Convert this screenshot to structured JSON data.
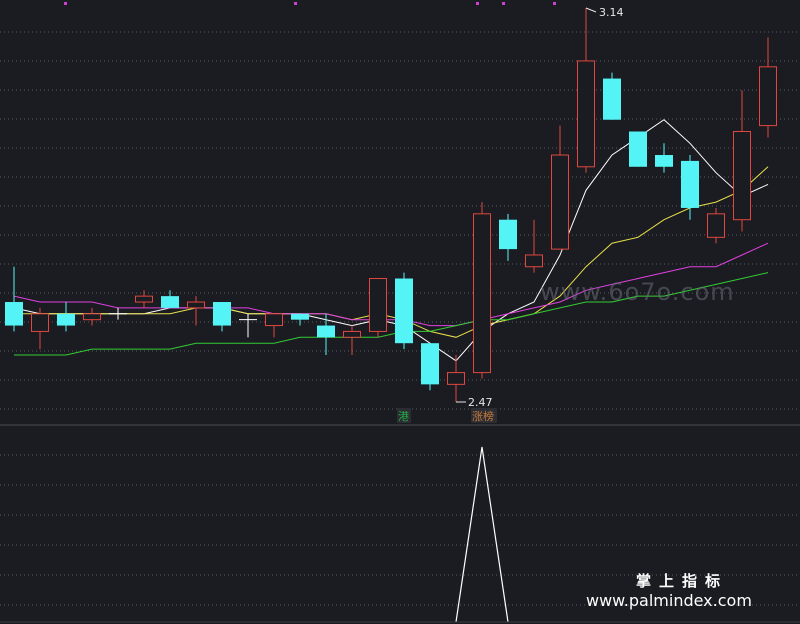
{
  "chart_data": {
    "type": "candlestick",
    "candles": [
      {
        "o": 2.64,
        "h": 2.7,
        "l": 2.59,
        "c": 2.6
      },
      {
        "o": 2.59,
        "h": 2.63,
        "l": 2.56,
        "c": 2.62
      },
      {
        "o": 2.62,
        "h": 2.64,
        "l": 2.59,
        "c": 2.6
      },
      {
        "o": 2.61,
        "h": 2.63,
        "l": 2.6,
        "c": 2.62
      },
      {
        "o": 2.62,
        "h": 2.63,
        "l": 2.61,
        "c": 2.62
      },
      {
        "o": 2.64,
        "h": 2.66,
        "l": 2.63,
        "c": 2.65
      },
      {
        "o": 2.65,
        "h": 2.66,
        "l": 2.63,
        "c": 2.63
      },
      {
        "o": 2.63,
        "h": 2.65,
        "l": 2.6,
        "c": 2.64
      },
      {
        "o": 2.64,
        "h": 2.64,
        "l": 2.59,
        "c": 2.6
      },
      {
        "o": 2.61,
        "h": 2.62,
        "l": 2.58,
        "c": 2.61
      },
      {
        "o": 2.6,
        "h": 2.61,
        "l": 2.58,
        "c": 2.62
      },
      {
        "o": 2.62,
        "h": 2.62,
        "l": 2.6,
        "c": 2.61
      },
      {
        "o": 2.6,
        "h": 2.62,
        "l": 2.55,
        "c": 2.58
      },
      {
        "o": 2.58,
        "h": 2.6,
        "l": 2.55,
        "c": 2.59
      },
      {
        "o": 2.59,
        "h": 2.68,
        "l": 2.58,
        "c": 2.68
      },
      {
        "o": 2.68,
        "h": 2.69,
        "l": 2.56,
        "c": 2.57
      },
      {
        "o": 2.57,
        "h": 2.57,
        "l": 2.49,
        "c": 2.5
      },
      {
        "o": 2.5,
        "h": 2.55,
        "l": 2.47,
        "c": 2.52
      },
      {
        "o": 2.52,
        "h": 2.81,
        "l": 2.51,
        "c": 2.79
      },
      {
        "o": 2.78,
        "h": 2.79,
        "l": 2.71,
        "c": 2.73
      },
      {
        "o": 2.7,
        "h": 2.78,
        "l": 2.69,
        "c": 2.72
      },
      {
        "o": 2.73,
        "h": 2.94,
        "l": 2.73,
        "c": 2.89
      },
      {
        "o": 2.87,
        "h": 3.14,
        "l": 2.86,
        "c": 3.05
      },
      {
        "o": 3.02,
        "h": 3.03,
        "l": 2.95,
        "c": 2.95
      },
      {
        "o": 2.93,
        "h": 2.93,
        "l": 2.87,
        "c": 2.87
      },
      {
        "o": 2.89,
        "h": 2.91,
        "l": 2.86,
        "c": 2.87
      },
      {
        "o": 2.88,
        "h": 2.89,
        "l": 2.78,
        "c": 2.8
      },
      {
        "o": 2.75,
        "h": 2.8,
        "l": 2.74,
        "c": 2.79
      },
      {
        "o": 2.78,
        "h": 3.0,
        "l": 2.76,
        "c": 2.93
      },
      {
        "o": 2.94,
        "h": 3.09,
        "l": 2.92,
        "c": 3.04
      }
    ],
    "high_label": "3.14",
    "low_label": "2.47",
    "tags": [
      {
        "text": "港",
        "index": 15,
        "color": "#22aa44"
      },
      {
        "text": "涨榜",
        "index": 18,
        "color": "#c87a3a"
      }
    ],
    "moving_averages": [
      {
        "color": "#ffffff",
        "values": [
          2.63,
          2.62,
          2.62,
          2.62,
          2.62,
          2.62,
          2.63,
          2.63,
          2.63,
          2.62,
          2.62,
          2.62,
          2.61,
          2.6,
          2.61,
          2.6,
          2.57,
          2.54,
          2.59,
          2.62,
          2.64,
          2.72,
          2.83,
          2.89,
          2.92,
          2.95,
          2.91,
          2.86,
          2.82,
          2.84
        ]
      },
      {
        "color": "#e8e04a",
        "values": [
          2.62,
          2.62,
          2.62,
          2.62,
          2.62,
          2.62,
          2.62,
          2.63,
          2.63,
          2.62,
          2.62,
          2.62,
          2.62,
          2.61,
          2.62,
          2.61,
          2.59,
          2.58,
          2.6,
          2.61,
          2.62,
          2.65,
          2.7,
          2.74,
          2.75,
          2.78,
          2.8,
          2.81,
          2.83,
          2.87
        ]
      },
      {
        "color": "#e040e0",
        "values": [
          2.65,
          2.64,
          2.64,
          2.64,
          2.63,
          2.63,
          2.63,
          2.63,
          2.63,
          2.63,
          2.62,
          2.62,
          2.62,
          2.61,
          2.61,
          2.61,
          2.6,
          2.6,
          2.61,
          2.62,
          2.63,
          2.64,
          2.66,
          2.67,
          2.68,
          2.69,
          2.7,
          2.7,
          2.72,
          2.74
        ]
      },
      {
        "color": "#33cc33",
        "values": [
          2.55,
          2.55,
          2.55,
          2.56,
          2.56,
          2.56,
          2.56,
          2.57,
          2.57,
          2.57,
          2.57,
          2.58,
          2.58,
          2.58,
          2.58,
          2.59,
          2.59,
          2.6,
          2.61,
          2.61,
          2.62,
          2.63,
          2.64,
          2.64,
          2.65,
          2.65,
          2.66,
          2.67,
          2.68,
          2.69
        ]
      }
    ],
    "indicator": {
      "peak_index": 18,
      "values": [
        0,
        0,
        0,
        0,
        0,
        0,
        0,
        0,
        0,
        0,
        0,
        0,
        0,
        0,
        0,
        0,
        0,
        0,
        1,
        0,
        0,
        0,
        0,
        0,
        0,
        0,
        0,
        0,
        0,
        0
      ]
    },
    "colors": {
      "up": "#e0473e",
      "down": "#54f4f6",
      "flat": "#ffffff",
      "grid": "#5a5d66",
      "background": "#1b1c22"
    }
  },
  "watermark": "www.6o7o.com",
  "brand": {
    "title": "掌上指标",
    "url": "www.palmindex.com"
  }
}
